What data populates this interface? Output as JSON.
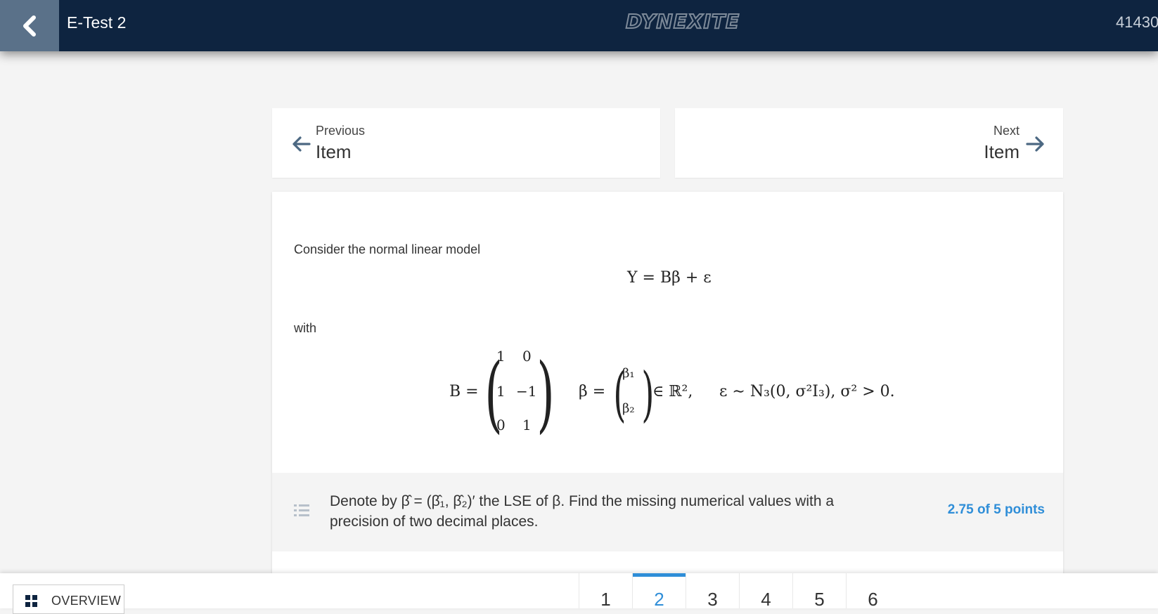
{
  "header": {
    "title": "E-Test 2",
    "brand": "DYNEXITE",
    "user_id": "41430"
  },
  "nav": {
    "previous_small": "Previous",
    "previous_big": "Item",
    "next_small": "Next",
    "next_big": "Item"
  },
  "question": {
    "intro": "Consider the normal linear model",
    "equation": "Y = Bβ + ε",
    "with": "with",
    "matrix_B_label": "B =",
    "matrix_B": [
      [
        "1",
        "0"
      ],
      [
        "1",
        "−1"
      ],
      [
        "0",
        "1"
      ]
    ],
    "beta_label": "β =",
    "beta_vector": [
      "β₁",
      "β₂"
    ],
    "beta_space": "∈ ℝ²,",
    "epsilon_dist": "ε ∼ N₃(0, σ²I₃),  σ² > 0.",
    "subquestion": "Denote by β̂ = (β̂₁, β̂₂)′ the LSE of β. Find the missing numerical values with a precision of two decimal places.",
    "points": "2.75 of 5 points"
  },
  "bottom": {
    "overview_label": "OVERVIEW",
    "tabs": [
      "1",
      "2",
      "3",
      "4",
      "5",
      "6"
    ],
    "active_tab": "2"
  },
  "colors": {
    "header_bg": "#0e2440",
    "accent": "#2f8ed8"
  }
}
